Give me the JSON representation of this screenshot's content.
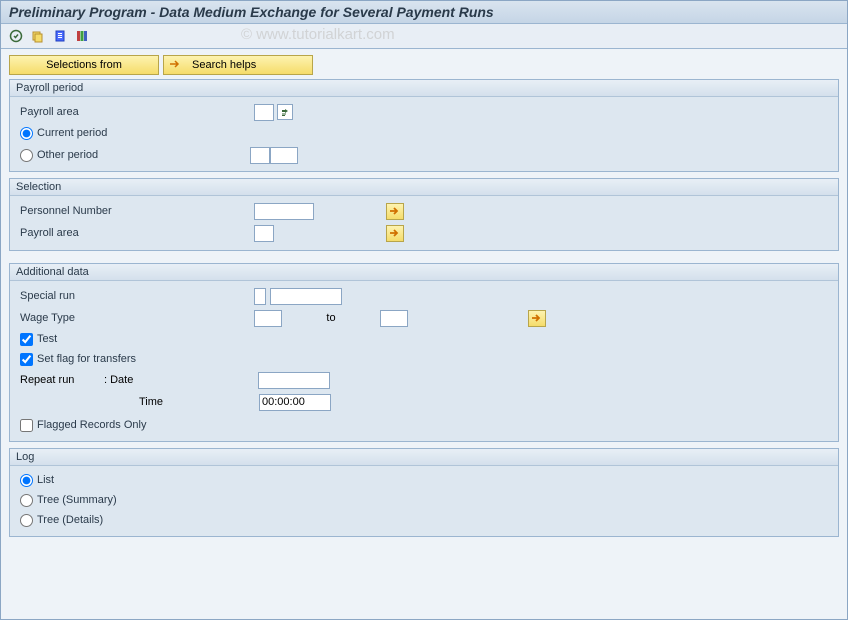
{
  "title": "Preliminary Program - Data Medium Exchange for Several Payment Runs",
  "watermark": "© www.tutorialkart.com",
  "buttons": {
    "selections_from": "Selections from",
    "search_helps": "Search helps"
  },
  "panels": {
    "payroll_period": {
      "title": "Payroll period",
      "payroll_area_label": "Payroll area",
      "payroll_area_value": "",
      "current_period_label": "Current period",
      "other_period_label": "Other period",
      "other_period_val1": "",
      "other_period_val2": ""
    },
    "selection": {
      "title": "Selection",
      "personnel_number_label": "Personnel Number",
      "personnel_number_value": "",
      "payroll_area_label": "Payroll area",
      "payroll_area_value": ""
    },
    "additional_data": {
      "title": "Additional data",
      "special_run_label": "Special run",
      "special_run_val1": "",
      "special_run_val2": "",
      "wage_type_label": "Wage Type",
      "wage_type_from": "",
      "wage_type_to_label": "to",
      "wage_type_to": "",
      "test_label": "Test",
      "set_flag_label": "Set flag for transfers",
      "repeat_run_label": "Repeat run",
      "repeat_run_date_label": ": Date",
      "repeat_run_date": "",
      "time_label": "Time",
      "time_value": "00:00:00",
      "flagged_only_label": "Flagged Records Only"
    },
    "log": {
      "title": "Log",
      "list_label": "List",
      "tree_summary_label": "Tree (Summary)",
      "tree_details_label": "Tree (Details)"
    }
  }
}
